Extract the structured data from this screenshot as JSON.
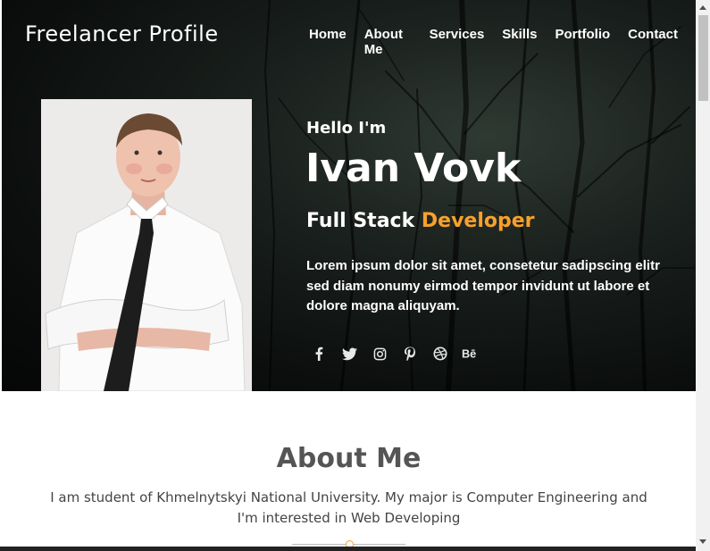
{
  "site": {
    "logo": "Freelancer Profile"
  },
  "nav": {
    "items": [
      "Home",
      "About Me",
      "Services",
      "Skills",
      "Portfolio",
      "Contact"
    ]
  },
  "hero": {
    "greeting": "Hello I'm",
    "name": "Ivan Vovk",
    "role_prefix": "Full Stack",
    "role_highlight": "Developer",
    "description": "Lorem ipsum dolor sit amet, consetetur sadipscing elitr sed diam nonumy eirmod tempor invidunt ut labore et dolore magna aliquyam.",
    "social_icons": [
      "facebook-icon",
      "twitter-icon",
      "instagram-icon",
      "pinterest-icon",
      "dribbble-icon",
      "behance-icon"
    ],
    "accent_color": "#f7a12c"
  },
  "about": {
    "title": "About Me",
    "text": "I am student of Khmelnytskyi National University. My major is Computer Engineering and I'm interested in Web Developing"
  }
}
